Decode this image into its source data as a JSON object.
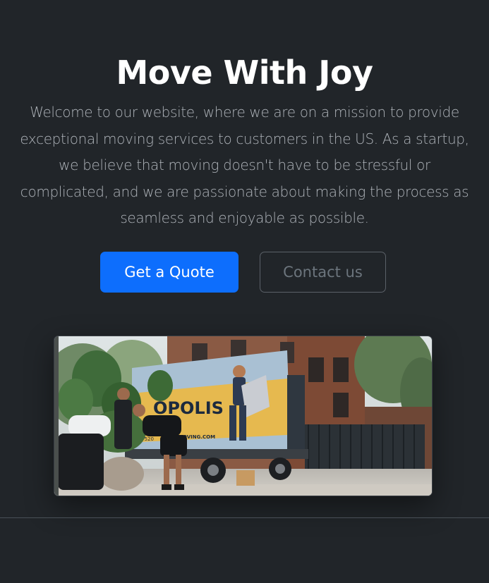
{
  "hero": {
    "title": "Move With Joy",
    "lead": "Welcome to our website, where we are on a mission to provide exceptional moving services to customers in the US. As a startup, we believe that moving doesn't have to be stressful or complicated, and we are passionate about making the process as seamless and enjoyable as possible.",
    "primary_button": "Get a Quote",
    "secondary_button": "Contact us"
  },
  "image": {
    "truck_brand_text": "OPOLIS",
    "truck_small_text": "G",
    "truck_website_text": "MOVING.COM",
    "truck_phone_text": "518 520"
  },
  "colors": {
    "background": "#212529",
    "primary": "#0d6efd",
    "title": "#ffffff",
    "lead": "#aeb3b9",
    "outline_text": "#6c757d"
  }
}
